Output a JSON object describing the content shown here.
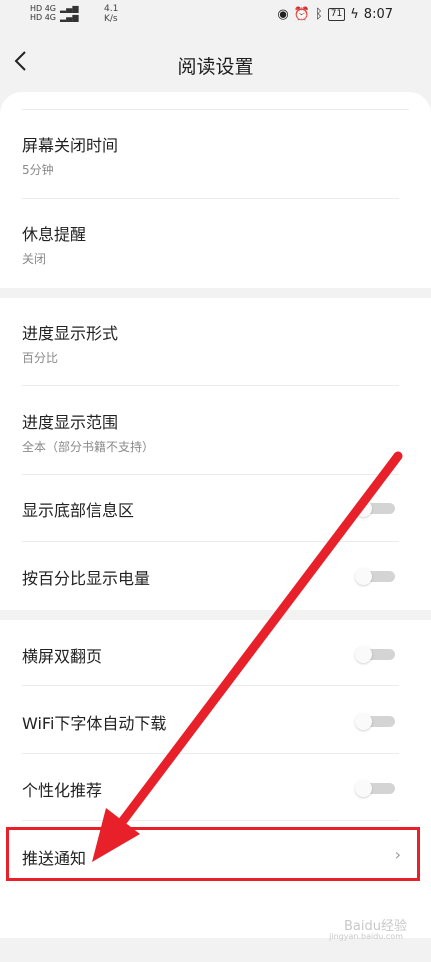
{
  "status_bar": {
    "sim1": "HD 4G",
    "sim2": "HD 4G",
    "speed_value": "4.1",
    "speed_unit": "K/s",
    "battery": "71",
    "time": "8:07"
  },
  "header": {
    "title": "阅读设置"
  },
  "settings": {
    "screen_off": {
      "label": "屏幕关闭时间",
      "value": "5分钟"
    },
    "rest_reminder": {
      "label": "休息提醒",
      "value": "关闭"
    },
    "progress_format": {
      "label": "进度显示形式",
      "value": "百分比"
    },
    "progress_range": {
      "label": "进度显示范围",
      "value": "全本（部分书籍不支持）"
    },
    "bottom_info": {
      "label": "显示底部信息区",
      "enabled": false
    },
    "battery_percent": {
      "label": "按百分比显示电量",
      "enabled": false
    },
    "landscape_double": {
      "label": "横屏双翻页",
      "enabled": false
    },
    "wifi_font_download": {
      "label": "WiFi下字体自动下载",
      "enabled": false
    },
    "personalized": {
      "label": "个性化推荐",
      "enabled": false
    },
    "push": {
      "label": "推送通知"
    }
  },
  "watermark": {
    "brand": "Baidu经验",
    "url": "jingyan.baidu.com"
  },
  "colors": {
    "annotation_red": "#e8202a",
    "toggle_off": "#d4d4d4"
  }
}
